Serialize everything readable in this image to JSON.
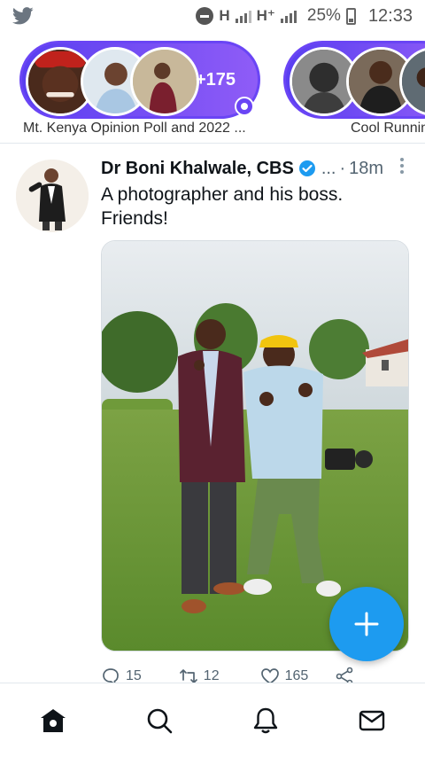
{
  "status_bar": {
    "network_1": "H",
    "network_2": "H⁺",
    "battery": "25%",
    "time": "12:33"
  },
  "fleets": [
    {
      "count": "+175",
      "label": "Mt. Kenya Opinion Poll and 2022 ..."
    },
    {
      "label": "Cool Runnin"
    }
  ],
  "tweet": {
    "author": "Dr Boni Khalwale, CBS",
    "handle": "...",
    "separator": "·",
    "time": "18m",
    "text": "A photographer and his boss. Friends!",
    "reply_count": "15",
    "retweet_count": "12",
    "like_count": "165"
  },
  "colors": {
    "accent": "#1d9bf0",
    "spaces_purple": "#6a45f5"
  },
  "nav": [
    "home-icon",
    "search-icon",
    "notifications-icon",
    "messages-icon"
  ]
}
